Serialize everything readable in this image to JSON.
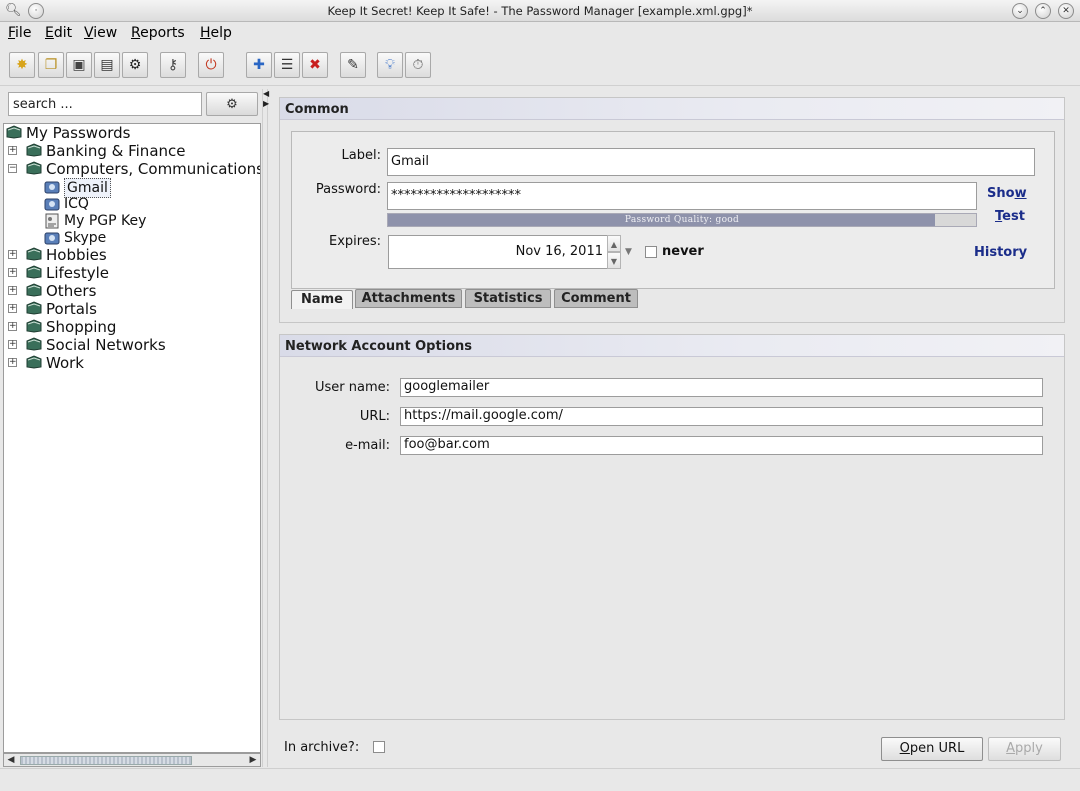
{
  "window": {
    "title": "Keep It Secret! Keep It Safe! - The Password Manager [example.xml.gpg]*"
  },
  "menu": [
    {
      "label": "File",
      "mnemonic": "F",
      "rest": "ile"
    },
    {
      "label": "Edit",
      "mnemonic": "E",
      "rest": "dit"
    },
    {
      "label": "View",
      "mnemonic": "V",
      "rest": "iew"
    },
    {
      "label": "Reports",
      "mnemonic": "R",
      "rest": "eports"
    },
    {
      "label": "Help",
      "mnemonic": "H",
      "rest": "elp"
    }
  ],
  "toolbar": {
    "icons": [
      "new-file-icon",
      "open-file-icon",
      "save-icon",
      "save-as-icon",
      "gear-icon",
      "key-icon",
      "power-icon",
      "add-icon",
      "list-icon",
      "delete-icon",
      "edit-icon",
      "bulb-icon",
      "clock-icon"
    ]
  },
  "search": {
    "placeholder": "search ...",
    "value": "search ..."
  },
  "tree": {
    "root": "My Passwords",
    "groups": [
      {
        "label": "Banking & Finance",
        "expanded": false
      },
      {
        "label": "Computers, Communications",
        "expanded": true,
        "children": [
          {
            "label": "Gmail",
            "selected": true
          },
          {
            "label": "ICQ"
          },
          {
            "label": "My PGP Key"
          },
          {
            "label": "Skype"
          }
        ]
      },
      {
        "label": "Hobbies",
        "expanded": false
      },
      {
        "label": "Lifestyle",
        "expanded": false
      },
      {
        "label": "Others",
        "expanded": false
      },
      {
        "label": "Portals",
        "expanded": false
      },
      {
        "label": "Shopping",
        "expanded": false
      },
      {
        "label": "Social Networks",
        "expanded": false
      },
      {
        "label": "Work",
        "expanded": false
      }
    ]
  },
  "common": {
    "heading": "Common",
    "label_label": "Label:",
    "label_value": "Gmail",
    "password_label": "Password:",
    "password_value": "********************",
    "quality_text": "Password Quality: good",
    "quality_fraction": 0.93,
    "show_link": {
      "mn": "",
      "rest_before": "Sho",
      "u": "w",
      "rest_after": ""
    },
    "test_link": {
      "u": "T",
      "rest": "est"
    },
    "expires_label": "Expires:",
    "expires_value": "Nov 16, 2011",
    "never_label": "never",
    "history_link": "History",
    "tabs": [
      "Name",
      "Attachments",
      "Statistics",
      "Comment"
    ]
  },
  "network": {
    "heading": "Network Account Options",
    "username_label": "User name:",
    "username_value": "googlemailer",
    "url_label": "URL:",
    "url_value": "https://mail.google.com/",
    "email_label": "e-mail:",
    "email_value": "foo@bar.com"
  },
  "footer": {
    "archive_label": "In archive?:",
    "open_url": {
      "u": "O",
      "rest": "pen URL"
    },
    "apply": {
      "u": "A",
      "rest": "pply"
    }
  },
  "colors": {
    "link": "#1b2d8a",
    "group_header": "#d9dbe8",
    "quality_fill": "#8e92ab"
  }
}
